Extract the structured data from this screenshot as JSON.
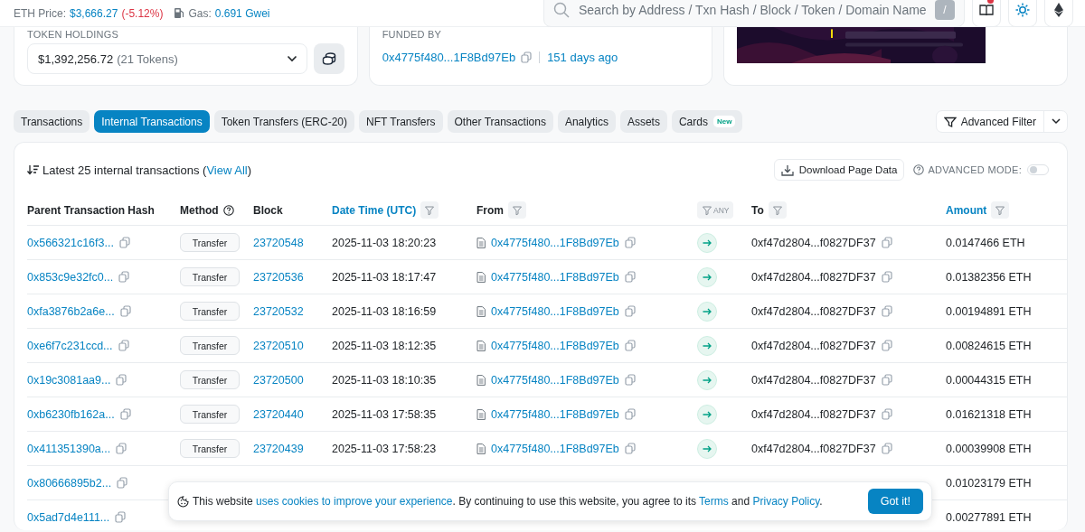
{
  "top_bar": {
    "eth_price_label": "ETH Price:",
    "eth_price": "$3,666.27",
    "eth_change": "(-5.12%)",
    "gas_label": "Gas:",
    "gas": "0.691 Gwei",
    "search": {
      "placeholder": "Search by Address / Txn Hash / Block / Token / Domain Name"
    },
    "shortcut": "/",
    "notification": true
  },
  "token_holdings": {
    "label": "TOKEN HOLDINGS",
    "value": "$1,392,256.72",
    "count": "(21 Tokens)"
  },
  "funded_by": {
    "label": "FUNDED BY",
    "address": "0x4775f480...1F8Bd97Eb",
    "age": "151 days ago"
  },
  "tabs": [
    {
      "label": "Transactions",
      "selected": false
    },
    {
      "label": "Internal Transactions",
      "selected": true
    },
    {
      "label": "Token Transfers (ERC-20)",
      "selected": false
    },
    {
      "label": "NFT Transfers",
      "selected": false
    },
    {
      "label": "Other Transactions",
      "selected": false
    },
    {
      "label": "Analytics",
      "selected": false
    },
    {
      "label": "Assets",
      "selected": false
    },
    {
      "label": "Cards",
      "selected": false,
      "badge": "New"
    }
  ],
  "advanced_filter": "Advanced Filter",
  "table": {
    "summary": "Latest 25 internal transactions",
    "summary_open": "(",
    "view_all": "View All",
    "summary_close": ")",
    "download": "Download Page Data",
    "advanced_mode": "ADVANCED MODE:",
    "advanced_mode_on": false,
    "columns": [
      {
        "label": "Parent Transaction Hash",
        "kind": "plain",
        "highlighted": false
      },
      {
        "label": "Method",
        "kind": "help",
        "highlighted": false
      },
      {
        "label": "Block",
        "kind": "plain",
        "highlighted": false
      },
      {
        "label": "Date Time (UTC)",
        "kind": "filter",
        "highlighted": true
      },
      {
        "label": "From",
        "kind": "filter",
        "highlighted": false
      },
      {
        "label": "ANY",
        "kind": "chip"
      },
      {
        "label": "To",
        "kind": "filter",
        "highlighted": false
      },
      {
        "label": "Amount",
        "kind": "filter",
        "highlighted": true
      }
    ],
    "rows": [
      {
        "hash": "0x566321c16f3...",
        "method": "Transfer",
        "block": "23720548",
        "time": "2025-11-03 18:20:23",
        "from": "0x4775f480...1F8Bd97Eb",
        "to": "0xf47d2804...f0827DF37",
        "amount": "0.0147466 ETH"
      },
      {
        "hash": "0x853c9e32fc0...",
        "method": "Transfer",
        "block": "23720536",
        "time": "2025-11-03 18:17:47",
        "from": "0x4775f480...1F8Bd97Eb",
        "to": "0xf47d2804...f0827DF37",
        "amount": "0.01382356 ETH"
      },
      {
        "hash": "0xfa3876b2a6e...",
        "method": "Transfer",
        "block": "23720532",
        "time": "2025-11-03 18:16:59",
        "from": "0x4775f480...1F8Bd97Eb",
        "to": "0xf47d2804...f0827DF37",
        "amount": "0.00194891 ETH"
      },
      {
        "hash": "0xe6f7c231ccd...",
        "method": "Transfer",
        "block": "23720510",
        "time": "2025-11-03 18:12:35",
        "from": "0x4775f480...1F8Bd97Eb",
        "to": "0xf47d2804...f0827DF37",
        "amount": "0.00824615 ETH"
      },
      {
        "hash": "0x19c3081aa9...",
        "method": "Transfer",
        "block": "23720500",
        "time": "2025-11-03 18:10:35",
        "from": "0x4775f480...1F8Bd97Eb",
        "to": "0xf47d2804...f0827DF37",
        "amount": "0.00044315 ETH"
      },
      {
        "hash": "0xb6230fb162a...",
        "method": "Transfer",
        "block": "23720440",
        "time": "2025-11-03 17:58:35",
        "from": "0x4775f480...1F8Bd97Eb",
        "to": "0xf47d2804...f0827DF37",
        "amount": "0.01621318 ETH"
      },
      {
        "hash": "0x411351390a...",
        "method": "Transfer",
        "block": "23720439",
        "time": "2025-11-03 17:58:23",
        "from": "0x4775f480...1F8Bd97Eb",
        "to": "0xf47d2804...f0827DF37",
        "amount": "0.00039908 ETH"
      },
      {
        "hash": "0x80666895b2...",
        "amount": "0.01023179 ETH"
      },
      {
        "hash": "0x5ad7d4e111...",
        "amount": "0.00277891 ETH"
      }
    ]
  },
  "cookie_banner": {
    "parts": [
      {
        "kind": "text",
        "text": "This website "
      },
      {
        "kind": "link",
        "text": "uses cookies to improve your experience"
      },
      {
        "kind": "text",
        "text": ". By continuing to use this website, you agree to its "
      },
      {
        "kind": "link",
        "text": "Terms"
      },
      {
        "kind": "text",
        "text": " and "
      },
      {
        "kind": "link",
        "text": "Privacy Policy"
      },
      {
        "kind": "text",
        "text": "."
      }
    ],
    "button": "Got it!"
  }
}
